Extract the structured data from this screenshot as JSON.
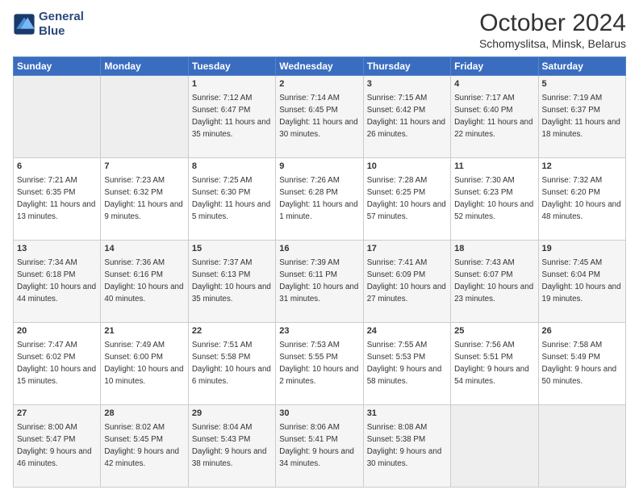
{
  "logo": {
    "line1": "General",
    "line2": "Blue"
  },
  "title": "October 2024",
  "subtitle": "Schomyslitsa, Minsk, Belarus",
  "days_header": [
    "Sunday",
    "Monday",
    "Tuesday",
    "Wednesday",
    "Thursday",
    "Friday",
    "Saturday"
  ],
  "weeks": [
    [
      {
        "day": "",
        "sunrise": "",
        "sunset": "",
        "daylight": ""
      },
      {
        "day": "",
        "sunrise": "",
        "sunset": "",
        "daylight": ""
      },
      {
        "day": "1",
        "sunrise": "Sunrise: 7:12 AM",
        "sunset": "Sunset: 6:47 PM",
        "daylight": "Daylight: 11 hours and 35 minutes."
      },
      {
        "day": "2",
        "sunrise": "Sunrise: 7:14 AM",
        "sunset": "Sunset: 6:45 PM",
        "daylight": "Daylight: 11 hours and 30 minutes."
      },
      {
        "day": "3",
        "sunrise": "Sunrise: 7:15 AM",
        "sunset": "Sunset: 6:42 PM",
        "daylight": "Daylight: 11 hours and 26 minutes."
      },
      {
        "day": "4",
        "sunrise": "Sunrise: 7:17 AM",
        "sunset": "Sunset: 6:40 PM",
        "daylight": "Daylight: 11 hours and 22 minutes."
      },
      {
        "day": "5",
        "sunrise": "Sunrise: 7:19 AM",
        "sunset": "Sunset: 6:37 PM",
        "daylight": "Daylight: 11 hours and 18 minutes."
      }
    ],
    [
      {
        "day": "6",
        "sunrise": "Sunrise: 7:21 AM",
        "sunset": "Sunset: 6:35 PM",
        "daylight": "Daylight: 11 hours and 13 minutes."
      },
      {
        "day": "7",
        "sunrise": "Sunrise: 7:23 AM",
        "sunset": "Sunset: 6:32 PM",
        "daylight": "Daylight: 11 hours and 9 minutes."
      },
      {
        "day": "8",
        "sunrise": "Sunrise: 7:25 AM",
        "sunset": "Sunset: 6:30 PM",
        "daylight": "Daylight: 11 hours and 5 minutes."
      },
      {
        "day": "9",
        "sunrise": "Sunrise: 7:26 AM",
        "sunset": "Sunset: 6:28 PM",
        "daylight": "Daylight: 11 hours and 1 minute."
      },
      {
        "day": "10",
        "sunrise": "Sunrise: 7:28 AM",
        "sunset": "Sunset: 6:25 PM",
        "daylight": "Daylight: 10 hours and 57 minutes."
      },
      {
        "day": "11",
        "sunrise": "Sunrise: 7:30 AM",
        "sunset": "Sunset: 6:23 PM",
        "daylight": "Daylight: 10 hours and 52 minutes."
      },
      {
        "day": "12",
        "sunrise": "Sunrise: 7:32 AM",
        "sunset": "Sunset: 6:20 PM",
        "daylight": "Daylight: 10 hours and 48 minutes."
      }
    ],
    [
      {
        "day": "13",
        "sunrise": "Sunrise: 7:34 AM",
        "sunset": "Sunset: 6:18 PM",
        "daylight": "Daylight: 10 hours and 44 minutes."
      },
      {
        "day": "14",
        "sunrise": "Sunrise: 7:36 AM",
        "sunset": "Sunset: 6:16 PM",
        "daylight": "Daylight: 10 hours and 40 minutes."
      },
      {
        "day": "15",
        "sunrise": "Sunrise: 7:37 AM",
        "sunset": "Sunset: 6:13 PM",
        "daylight": "Daylight: 10 hours and 35 minutes."
      },
      {
        "day": "16",
        "sunrise": "Sunrise: 7:39 AM",
        "sunset": "Sunset: 6:11 PM",
        "daylight": "Daylight: 10 hours and 31 minutes."
      },
      {
        "day": "17",
        "sunrise": "Sunrise: 7:41 AM",
        "sunset": "Sunset: 6:09 PM",
        "daylight": "Daylight: 10 hours and 27 minutes."
      },
      {
        "day": "18",
        "sunrise": "Sunrise: 7:43 AM",
        "sunset": "Sunset: 6:07 PM",
        "daylight": "Daylight: 10 hours and 23 minutes."
      },
      {
        "day": "19",
        "sunrise": "Sunrise: 7:45 AM",
        "sunset": "Sunset: 6:04 PM",
        "daylight": "Daylight: 10 hours and 19 minutes."
      }
    ],
    [
      {
        "day": "20",
        "sunrise": "Sunrise: 7:47 AM",
        "sunset": "Sunset: 6:02 PM",
        "daylight": "Daylight: 10 hours and 15 minutes."
      },
      {
        "day": "21",
        "sunrise": "Sunrise: 7:49 AM",
        "sunset": "Sunset: 6:00 PM",
        "daylight": "Daylight: 10 hours and 10 minutes."
      },
      {
        "day": "22",
        "sunrise": "Sunrise: 7:51 AM",
        "sunset": "Sunset: 5:58 PM",
        "daylight": "Daylight: 10 hours and 6 minutes."
      },
      {
        "day": "23",
        "sunrise": "Sunrise: 7:53 AM",
        "sunset": "Sunset: 5:55 PM",
        "daylight": "Daylight: 10 hours and 2 minutes."
      },
      {
        "day": "24",
        "sunrise": "Sunrise: 7:55 AM",
        "sunset": "Sunset: 5:53 PM",
        "daylight": "Daylight: 9 hours and 58 minutes."
      },
      {
        "day": "25",
        "sunrise": "Sunrise: 7:56 AM",
        "sunset": "Sunset: 5:51 PM",
        "daylight": "Daylight: 9 hours and 54 minutes."
      },
      {
        "day": "26",
        "sunrise": "Sunrise: 7:58 AM",
        "sunset": "Sunset: 5:49 PM",
        "daylight": "Daylight: 9 hours and 50 minutes."
      }
    ],
    [
      {
        "day": "27",
        "sunrise": "Sunrise: 8:00 AM",
        "sunset": "Sunset: 5:47 PM",
        "daylight": "Daylight: 9 hours and 46 minutes."
      },
      {
        "day": "28",
        "sunrise": "Sunrise: 8:02 AM",
        "sunset": "Sunset: 5:45 PM",
        "daylight": "Daylight: 9 hours and 42 minutes."
      },
      {
        "day": "29",
        "sunrise": "Sunrise: 8:04 AM",
        "sunset": "Sunset: 5:43 PM",
        "daylight": "Daylight: 9 hours and 38 minutes."
      },
      {
        "day": "30",
        "sunrise": "Sunrise: 8:06 AM",
        "sunset": "Sunset: 5:41 PM",
        "daylight": "Daylight: 9 hours and 34 minutes."
      },
      {
        "day": "31",
        "sunrise": "Sunrise: 8:08 AM",
        "sunset": "Sunset: 5:38 PM",
        "daylight": "Daylight: 9 hours and 30 minutes."
      },
      {
        "day": "",
        "sunrise": "",
        "sunset": "",
        "daylight": ""
      },
      {
        "day": "",
        "sunrise": "",
        "sunset": "",
        "daylight": ""
      }
    ]
  ]
}
